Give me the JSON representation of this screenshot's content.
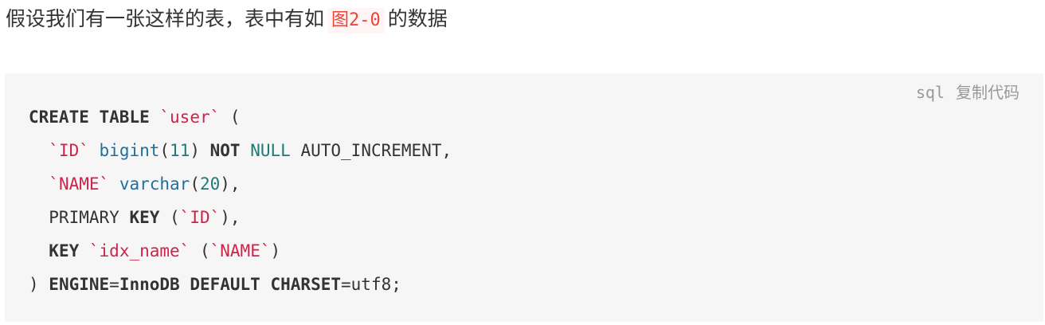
{
  "intro": {
    "text_before": "假设我们有一张这样的表，表中有如",
    "ref": "图2-0",
    "text_after": "的数据"
  },
  "code_block": {
    "language": "sql",
    "copy_label": "复制代码",
    "lines": [
      [
        {
          "t": "CREATE",
          "c": "kw"
        },
        {
          "t": " ",
          "c": "plain"
        },
        {
          "t": "TABLE",
          "c": "kw"
        },
        {
          "t": " ",
          "c": "plain"
        },
        {
          "t": "`user`",
          "c": "str"
        },
        {
          "t": " (",
          "c": "plain"
        }
      ],
      [
        {
          "t": "  ",
          "c": "plain"
        },
        {
          "t": "`ID`",
          "c": "str"
        },
        {
          "t": " ",
          "c": "plain"
        },
        {
          "t": "bigint",
          "c": "type"
        },
        {
          "t": "(",
          "c": "plain"
        },
        {
          "t": "11",
          "c": "num"
        },
        {
          "t": ") ",
          "c": "plain"
        },
        {
          "t": "NOT",
          "c": "kw"
        },
        {
          "t": " ",
          "c": "plain"
        },
        {
          "t": "NULL",
          "c": "num"
        },
        {
          "t": " AUTO_INCREMENT,",
          "c": "plain"
        }
      ],
      [
        {
          "t": "  ",
          "c": "plain"
        },
        {
          "t": "`NAME`",
          "c": "str"
        },
        {
          "t": " ",
          "c": "plain"
        },
        {
          "t": "varchar",
          "c": "type"
        },
        {
          "t": "(",
          "c": "plain"
        },
        {
          "t": "20",
          "c": "num"
        },
        {
          "t": "),",
          "c": "plain"
        }
      ],
      [
        {
          "t": "  PRIMARY ",
          "c": "plain"
        },
        {
          "t": "KEY",
          "c": "kw"
        },
        {
          "t": " (",
          "c": "plain"
        },
        {
          "t": "`ID`",
          "c": "str"
        },
        {
          "t": "),",
          "c": "plain"
        }
      ],
      [
        {
          "t": "  ",
          "c": "plain"
        },
        {
          "t": "KEY",
          "c": "kw"
        },
        {
          "t": " ",
          "c": "plain"
        },
        {
          "t": "`idx_name`",
          "c": "str"
        },
        {
          "t": " (",
          "c": "plain"
        },
        {
          "t": "`NAME`",
          "c": "str"
        },
        {
          "t": ")",
          "c": "plain"
        }
      ],
      [
        {
          "t": ") ",
          "c": "plain"
        },
        {
          "t": "ENGINE",
          "c": "kw"
        },
        {
          "t": "=",
          "c": "plain"
        },
        {
          "t": "InnoDB",
          "c": "kw"
        },
        {
          "t": " ",
          "c": "plain"
        },
        {
          "t": "DEFAULT",
          "c": "kw"
        },
        {
          "t": " ",
          "c": "plain"
        },
        {
          "t": "CHARSET",
          "c": "kw"
        },
        {
          "t": "=utf8;",
          "c": "plain"
        }
      ]
    ]
  }
}
